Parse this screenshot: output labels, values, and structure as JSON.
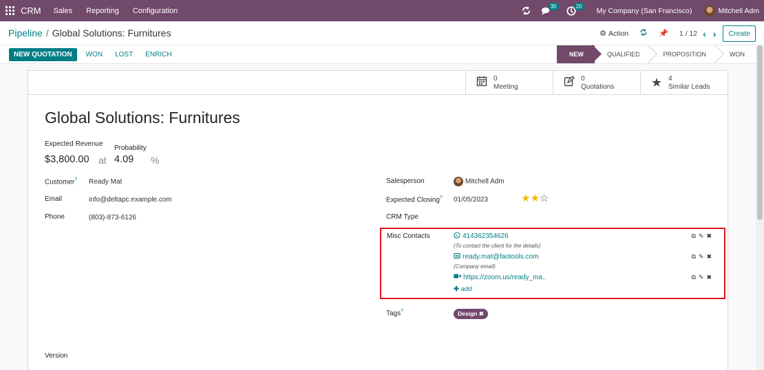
{
  "navbar": {
    "app_name": "CRM",
    "menu": [
      "Sales",
      "Reporting",
      "Configuration"
    ],
    "chat_badge": "30",
    "activity_badge": "20",
    "company": "My Company (San Francisco)",
    "user": "Mitchell Adm"
  },
  "breadcrumb": {
    "parent": "Pipeline",
    "separator": "/",
    "current": "Global Solutions: Furnitures"
  },
  "control": {
    "action_label": "Action",
    "pager": "1 / 12",
    "create_label": "Create"
  },
  "statusbar": {
    "new_quotation": "NEW QUOTATION",
    "won": "WON",
    "lost": "LOST",
    "enrich": "ENRICH",
    "stages": [
      "NEW",
      "QUALIFIED",
      "PROPOSITION",
      "WON"
    ],
    "active_stage": "NEW"
  },
  "smart_buttons": [
    {
      "count": "0",
      "label": "Meeting",
      "icon": "calendar-icon"
    },
    {
      "count": "0",
      "label": "Quotations",
      "icon": "edit-icon"
    },
    {
      "count": "4",
      "label": "Similar Leads",
      "icon": "star-icon"
    }
  ],
  "lead": {
    "title": "Global Solutions: Furnitures",
    "expected_revenue_label": "Expected Revenue",
    "probability_label": "Probability",
    "expected_revenue": "$3,800.00",
    "at": "at",
    "probability": "4.09",
    "percent": "%"
  },
  "left_fields": {
    "customer_label": "Customer",
    "customer_help": "?",
    "customer": "Ready Mat",
    "email_label": "Email",
    "email": "info@deltapc.example.com",
    "phone_label": "Phone",
    "phone": "(803)-873-6126",
    "version_label": "Version"
  },
  "right_fields": {
    "salesperson_label": "Salesperson",
    "salesperson": "Mitchell Adm",
    "expected_closing_label": "Expected Closing",
    "expected_closing_help": "?",
    "expected_closing": "01/05/2023",
    "priority_stars": 2,
    "priority_max": 3,
    "crm_type_label": "CRM Type",
    "misc_contacts_label": "Misc Contacts",
    "tags_label": "Tags",
    "tags_help": "?",
    "tags": [
      "Design"
    ]
  },
  "misc_contacts": [
    {
      "icon": "whatsapp-icon",
      "value": "414362354626",
      "note": "(To contact the client for the details)"
    },
    {
      "icon": "email-icon",
      "value": "ready.mat@faotools.com",
      "note": "(Company email)"
    },
    {
      "icon": "video-icon",
      "value": "https://zoom.us/ready_ma..",
      "note": ""
    }
  ],
  "misc_add_label": "add",
  "colors": {
    "brand": "#71496a",
    "accent": "#017e84",
    "highlight": "#e0141e",
    "star": "#f3b900"
  }
}
